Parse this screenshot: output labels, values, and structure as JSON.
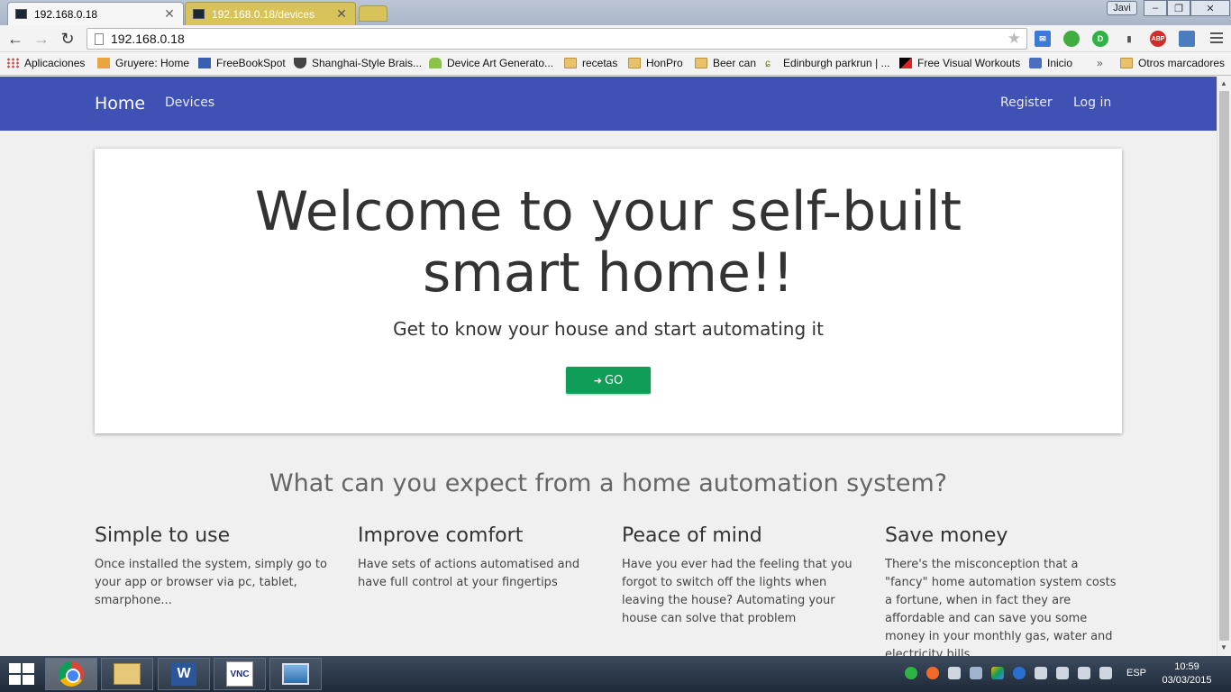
{
  "browser": {
    "tabs": [
      {
        "title": "192.168.0.18",
        "active": true
      },
      {
        "title": "192.168.0.18/devices",
        "active": false
      }
    ],
    "user_badge": "Javi",
    "window_controls": {
      "minimize": "–",
      "restore": "❐",
      "close": "✕"
    },
    "address": "192.168.0.18",
    "extensions": [
      {
        "name": "mail-icon",
        "color": "#3b7bd8",
        "label": "✉"
      },
      {
        "name": "evernote-icon",
        "color": "#3fae3f",
        "label": ""
      },
      {
        "name": "pushbullet-icon",
        "color": "#2fb344",
        "label": "D"
      },
      {
        "name": "signal-icon",
        "color": "#888888",
        "label": ""
      },
      {
        "name": "adblock-icon",
        "color": "#d42b2b",
        "label": "ABP"
      },
      {
        "name": "ext-icon",
        "color": "#4a7dc0",
        "label": ""
      }
    ],
    "bookmarks": [
      {
        "label": "Aplicaciones",
        "icon": "apps-icon"
      },
      {
        "label": "Gruyere: Home",
        "icon": "page-icon"
      },
      {
        "label": "FreeBookSpot",
        "icon": "page-icon"
      },
      {
        "label": "Shanghai-Style Brais...",
        "icon": "bowl-icon"
      },
      {
        "label": "Device Art Generato...",
        "icon": "android-icon"
      },
      {
        "label": "recetas",
        "icon": "folder-icon"
      },
      {
        "label": "HonPro",
        "icon": "folder-icon"
      },
      {
        "label": "Beer can",
        "icon": "folder-icon"
      },
      {
        "label": "Edinburgh parkrun | ...",
        "icon": "parkrun-icon"
      },
      {
        "label": "Free Visual Workouts",
        "icon": "workout-icon"
      },
      {
        "label": "Inicio",
        "icon": "page-icon"
      }
    ],
    "bookmarks_overflow": "»",
    "other_bookmarks": "Otros marcadores"
  },
  "site": {
    "nav": {
      "brand": "Home",
      "devices": "Devices",
      "register": "Register",
      "login": "Log in"
    },
    "hero": {
      "title": "Welcome to your self-built smart home!!",
      "subtitle": "Get to know your house and start automating it",
      "button": "GO",
      "button_icon": "➜"
    },
    "section_title": "What can you expect from a home automation system?",
    "features": [
      {
        "title": "Simple to use",
        "text": "Once installed the system, simply go to your app or browser via pc, tablet, smarphone..."
      },
      {
        "title": "Improve comfort",
        "text": "Have sets of actions automatised and have full control at your fingertips"
      },
      {
        "title": "Peace of mind",
        "text": "Have you ever had the feeling that you forgot to switch off the lights when leaving the house? Automating your house can solve that problem"
      },
      {
        "title": "Save money",
        "text": "There's the misconception that a \"fancy\" home automation system costs a fortune, when in fact they are affordable and can save you some money in your monthly gas, water and electricity bills"
      }
    ],
    "colors": {
      "navbar": "#3f51b5",
      "go_button": "#0f9d58"
    }
  },
  "taskbar": {
    "apps": [
      "chrome-icon",
      "file-explorer-icon",
      "word-icon",
      "vnc-icon",
      "photos-icon"
    ],
    "language": "ESP",
    "time": "10:59",
    "date": "03/03/2015"
  }
}
